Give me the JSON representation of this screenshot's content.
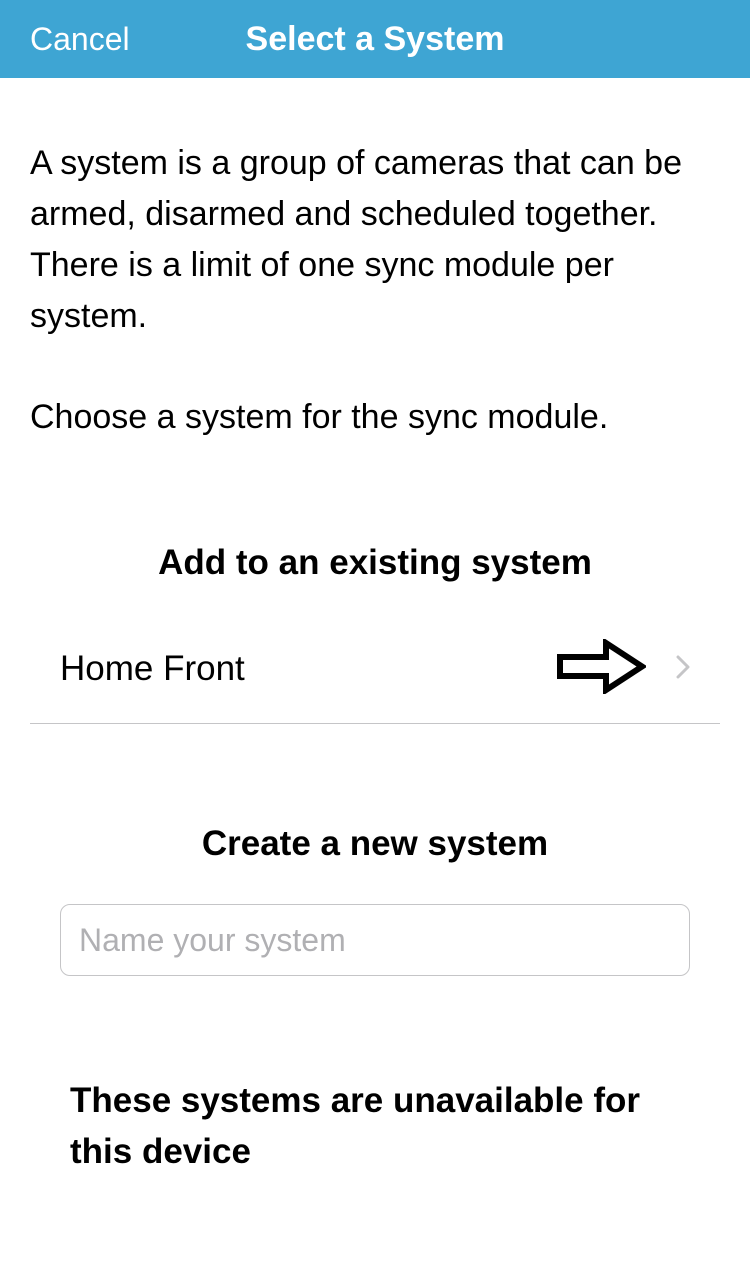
{
  "header": {
    "cancel_label": "Cancel",
    "title": "Select a System"
  },
  "description": {
    "para1": "A system is a group of cameras that can be armed, disarmed and scheduled together. There is a limit of one sync module per system.",
    "para2": "Choose a system for the sync module."
  },
  "existing_section": {
    "heading": "Add to an existing system",
    "systems": [
      {
        "name": "Home Front"
      }
    ]
  },
  "create_section": {
    "heading": "Create a new system",
    "placeholder": "Name your system",
    "value": ""
  },
  "unavailable_section": {
    "heading": "These systems are unavailable for this device"
  }
}
